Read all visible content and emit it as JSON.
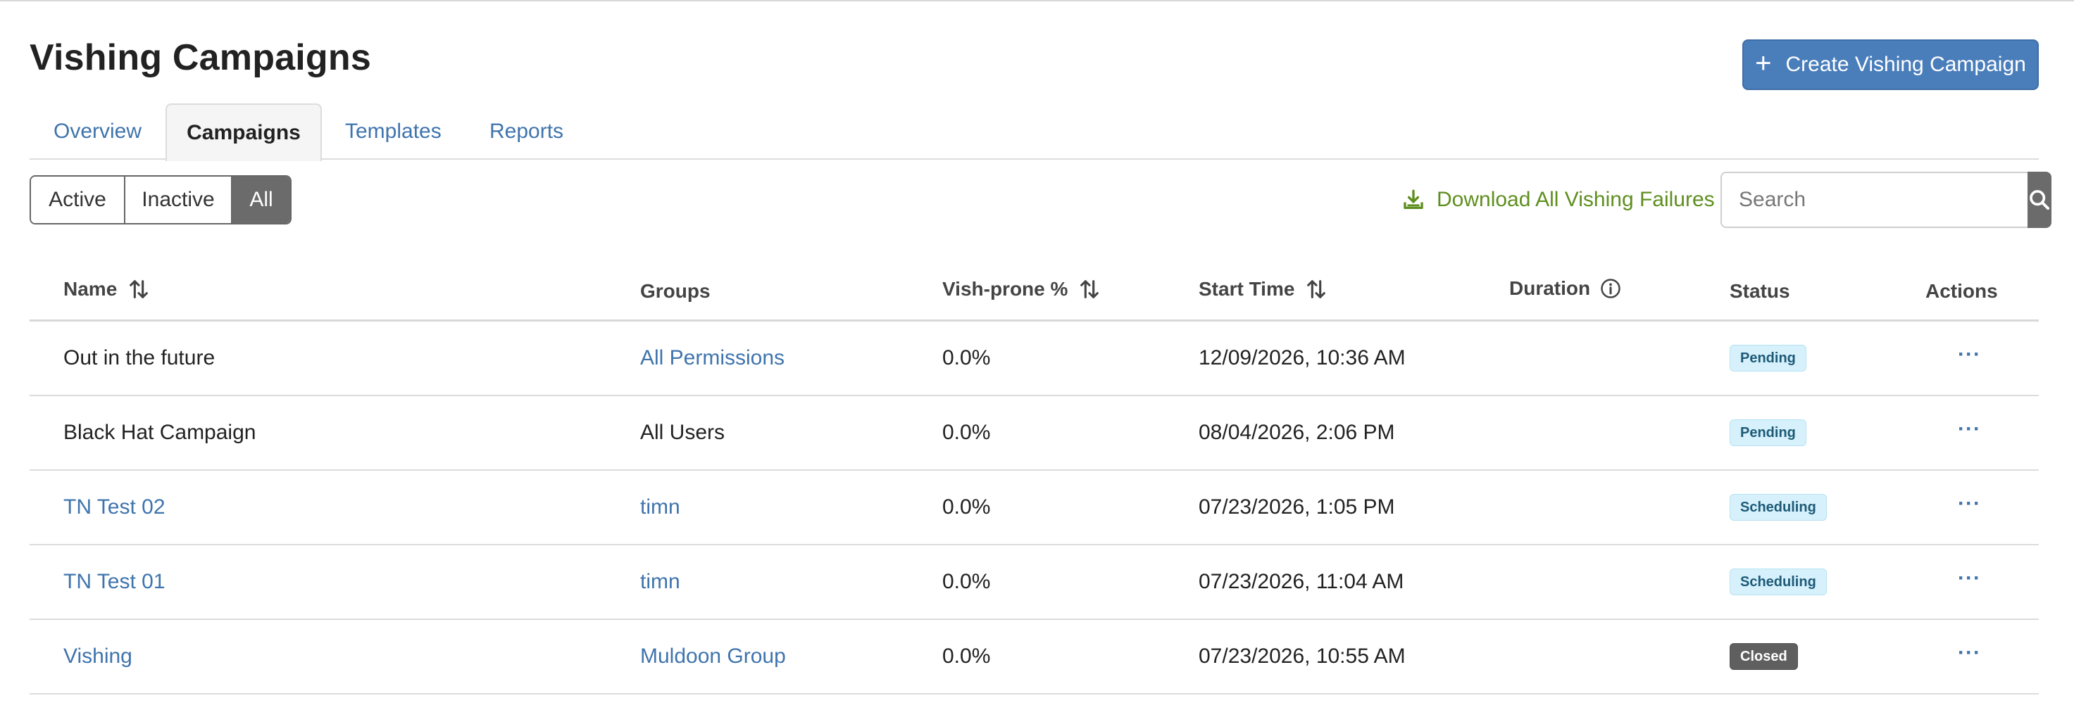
{
  "page": {
    "title": "Vishing Campaigns"
  },
  "header": {
    "create_button_label": "Create Vishing Campaign"
  },
  "tabs": [
    {
      "label": "Overview",
      "active": false
    },
    {
      "label": "Campaigns",
      "active": true
    },
    {
      "label": "Templates",
      "active": false
    },
    {
      "label": "Reports",
      "active": false
    }
  ],
  "filters": [
    {
      "label": "Active",
      "selected": false
    },
    {
      "label": "Inactive",
      "selected": false
    },
    {
      "label": "All",
      "selected": true
    }
  ],
  "toolbar": {
    "download_label": "Download All Vishing Failures",
    "search_placeholder": "Search"
  },
  "table": {
    "columns": [
      "Name",
      "Groups",
      "Vish-prone %",
      "Start Time",
      "Duration",
      "Status",
      "Actions"
    ],
    "rows": [
      {
        "name": "Out in the future",
        "name_link": false,
        "group": "All Permissions",
        "group_link": true,
        "vish_prone": "0.0%",
        "start_time": "12/09/2026, 10:36 AM",
        "duration": "",
        "status": "Pending",
        "actions": "···"
      },
      {
        "name": "Black Hat Campaign",
        "name_link": false,
        "group": "All Users",
        "group_link": false,
        "vish_prone": "0.0%",
        "start_time": "08/04/2026, 2:06 PM",
        "duration": "",
        "status": "Pending",
        "actions": "···"
      },
      {
        "name": "TN Test 02",
        "name_link": true,
        "group": "timn",
        "group_link": true,
        "vish_prone": "0.0%",
        "start_time": "07/23/2026, 1:05 PM",
        "duration": "",
        "status": "Scheduling",
        "actions": "···"
      },
      {
        "name": "TN Test 01",
        "name_link": true,
        "group": "timn",
        "group_link": true,
        "vish_prone": "0.0%",
        "start_time": "07/23/2026, 11:04 AM",
        "duration": "",
        "status": "Scheduling",
        "actions": "···"
      },
      {
        "name": "Vishing",
        "name_link": true,
        "group": "Muldoon Group",
        "group_link": true,
        "vish_prone": "0.0%",
        "start_time": "07/23/2026, 10:55 AM",
        "duration": "",
        "status": "Closed",
        "actions": "···"
      }
    ]
  },
  "colors": {
    "primary": "#4a7ebb",
    "link": "#3f74ad",
    "download_green": "#5f8f1f",
    "pending_bg": "#d6f1fb",
    "closed_bg": "#5f5f5f"
  }
}
